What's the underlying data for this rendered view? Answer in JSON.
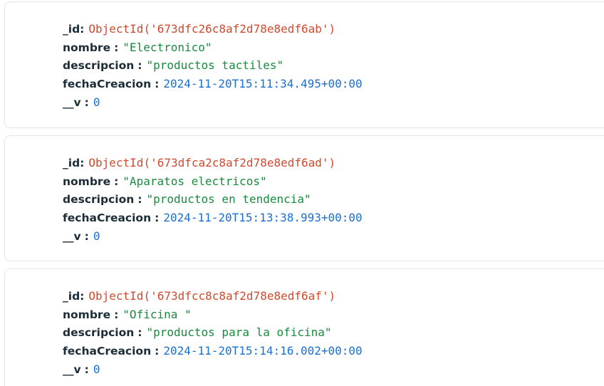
{
  "labels": {
    "id": "_id",
    "nombre": "nombre",
    "descripcion": "descripcion",
    "fechaCreacion": "fechaCreacion",
    "v": "__v",
    "colon": ":"
  },
  "documents": [
    {
      "id": "ObjectId('673dfc26c8af2d78e8edf6ab')",
      "nombre": "\"Electronico\"",
      "descripcion": "\"productos tactiles\"",
      "fechaCreacion": "2024-11-20T15:11:34.495+00:00",
      "v": "0"
    },
    {
      "id": "ObjectId('673dfca2c8af2d78e8edf6ad')",
      "nombre": "\"Aparatos electricos\"",
      "descripcion": "\"productos en tendencia\"",
      "fechaCreacion": "2024-11-20T15:13:38.993+00:00",
      "v": "0"
    },
    {
      "id": "ObjectId('673dfcc8c8af2d78e8edf6af')",
      "nombre": "\"Oficina \"",
      "descripcion": "\"productos para la oficina\"",
      "fechaCreacion": "2024-11-20T15:14:16.002+00:00",
      "v": "0"
    }
  ],
  "colors": {
    "key": "#1c2d38",
    "objectid": "#d04a2f",
    "string": "#1a8a3e",
    "date": "#1a6fd1",
    "number": "#1a6fd1",
    "card_border": "#e3e6e8"
  }
}
